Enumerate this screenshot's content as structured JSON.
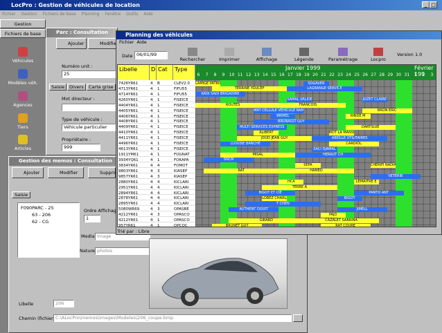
{
  "app": {
    "title": "LocPro : Gestion de véhicules de location",
    "menu": [
      "Fichier",
      "Gestion",
      "Fichiers de base",
      "Planning",
      "Fenêtre",
      "Outils",
      "Aide"
    ]
  },
  "leftbar": {
    "tabs": [
      "Gestion",
      "Fichiers de base"
    ],
    "items": [
      "Véhicules",
      "Modèles véh.",
      "Agences",
      "Tiers",
      "Articles"
    ]
  },
  "parc": {
    "title": "Parc : Consultation",
    "add": "Ajouter",
    "modify": "Modifier",
    "numero_label": "Numéro unit :",
    "numero_value": "25",
    "tabs": [
      "Saisie",
      "Divers",
      "Carte grise"
    ],
    "mot_label": "Mot directeur :",
    "type_label": "Type de véhicule :",
    "type_value": "Véhicule particulier",
    "prop_label": "Propriétaire :",
    "prop_value": "999"
  },
  "memos": {
    "title": "Gestion des memos : Consultation",
    "add": "Ajouter",
    "modify": "Modifier",
    "delete": "Supprimer",
    "tab": "Saisie",
    "tree": [
      "F090PARC - 25",
      "63 - 206",
      "62 - CG"
    ],
    "ordre_label": "Ordre Affichage",
    "ordre_value": "1",
    "media_label": "Media",
    "media_value": "Image",
    "nature_label": "Nature",
    "nature_value": "photos",
    "libelle_label": "Libelle",
    "libelle_value": "206",
    "chemin_label": "Chemin (fichier)",
    "chemin_value": "C:\\ALocPro\\memos\\images\\Modeles\\206_coupe.bmp"
  },
  "planning": {
    "title": "Planning des véhicules",
    "menu": [
      "Fichier",
      "Aide"
    ],
    "date_label": "Date",
    "date_value": "06/01/99",
    "toolbar": [
      "Rechercher",
      "Imprimer",
      "Affichage",
      "Légende",
      "Paramétrage",
      "Locpro",
      "Version 1.0"
    ],
    "headers": [
      "Libelle",
      "D",
      "Cat",
      "Type"
    ],
    "month": "Janvier 1999",
    "next_month": "Février 199",
    "days": [
      "6",
      "7",
      "8",
      "9",
      "10",
      "11",
      "12",
      "13",
      "14",
      "15",
      "16",
      "17",
      "18",
      "19",
      "20",
      "21",
      "22",
      "23",
      "24",
      "25",
      "26",
      "27",
      "28",
      "29",
      "30",
      "31",
      "1",
      "2",
      "3"
    ],
    "rows": [
      [
        "7426YR61",
        "4",
        "B",
        "CLEV2.0"
      ],
      [
        "4713YR61",
        "4",
        "1",
        "FIFU55"
      ],
      [
        "4714YR61",
        "4",
        "1",
        "FIFU55"
      ],
      [
        "4260YR61",
        "4",
        "1",
        "FISEICE"
      ],
      [
        "4404YR61",
        "4",
        "1",
        "FISEICE"
      ],
      [
        "4405YR61",
        "4",
        "1",
        "FISEICE"
      ],
      [
        "4406YR61",
        "4",
        "1",
        "FISEICE"
      ],
      [
        "4408YR61",
        "4",
        "1",
        "FISEICE"
      ],
      [
        "4409YR61",
        "4",
        "1",
        "FISEICE"
      ],
      [
        "4410YR61",
        "4",
        "1",
        "FISEICE"
      ],
      [
        "4411YR61",
        "4",
        "1",
        "FISEICE"
      ],
      [
        "4496YR61",
        "4",
        "1",
        "FISEICE"
      ],
      [
        "4613YR61",
        "4",
        "1",
        "FISEICE"
      ],
      [
        "1911YM61",
        "4",
        "1",
        "FOGNAT"
      ],
      [
        "3934YQ61",
        "4",
        "1",
        "FOKAPA"
      ],
      [
        "3834YR61",
        "4",
        "4",
        "FOMOT"
      ],
      [
        "9803YR61",
        "4",
        "3",
        "KIASEP"
      ],
      [
        "9857YR61",
        "4",
        "3",
        "KIASEP"
      ],
      [
        "2880YR61",
        "4",
        "4",
        "KICLARI"
      ],
      [
        "2951YR61",
        "4",
        "4",
        "KICLARI"
      ],
      [
        "2894YR61",
        "4",
        "4",
        "KICLARI"
      ],
      [
        "2878YR61",
        "4",
        "4",
        "KICLARI"
      ],
      [
        "2895YR61",
        "4",
        "4",
        "KICLARI"
      ],
      [
        "5080WR69",
        "4",
        "3",
        "OPASBE"
      ],
      [
        "4212YR61",
        "4",
        "3",
        "OPASCO"
      ],
      [
        "4212YR61",
        "4",
        "1",
        "OPASCO"
      ],
      [
        "957YR61",
        "4",
        "1",
        "OPCOC"
      ]
    ],
    "bars": [
      "LAMIGE PATRICK",
      "MAT CELLULE VEHICULE RAMP",
      "ABEILLE UTILITAIRES",
      "CHERIFI NADIA",
      "BIGOT ET CIE",
      "CAZALET SABRINA",
      "JOZET CLAIRE",
      "MULTI SERVICES EXPRESS",
      "HERAUT CH",
      "LEMAITRE E",
      "AUTHENT DOUIT",
      "LAGRANGE SERVICE",
      "RINDE M",
      "LLOUISE BANCHE",
      "HAMED",
      "BIGOT",
      "BRUNET GUY",
      "FRANCOIS",
      "MOT LA MANSUR",
      "SNCM",
      "TERRE A",
      "PAJD",
      "KADI SADI BRIGADIRE",
      "BRUNAULT GUY",
      "SACI DJAMAL",
      "VETERIB",
      "T CHEN",
      "SOGAVER",
      "BRON ERIC",
      "JOUD JEAN GUY",
      "SEPA",
      "PANTO ANT",
      "GIRARD",
      "SAMAL VALIDE",
      "DARTIGUE",
      "MISAL",
      "HCA",
      "JIMELL",
      "TERRINE YOUCEF",
      "BRIHEL",
      "CARDIOL",
      "RAT",
      "LOBEZ CHARLES",
      "RAT COURE",
      "ROUTES",
      "ALIBERT"
    ],
    "footer": "Trié par : Libre"
  },
  "colors": {
    "grid": "#808080",
    "weekend": "#2ee02e",
    "bar_blue": "#2c6ef0",
    "bar_yellow": "#ffff30",
    "header": "#ffff40",
    "month": "#1a8a2a"
  }
}
